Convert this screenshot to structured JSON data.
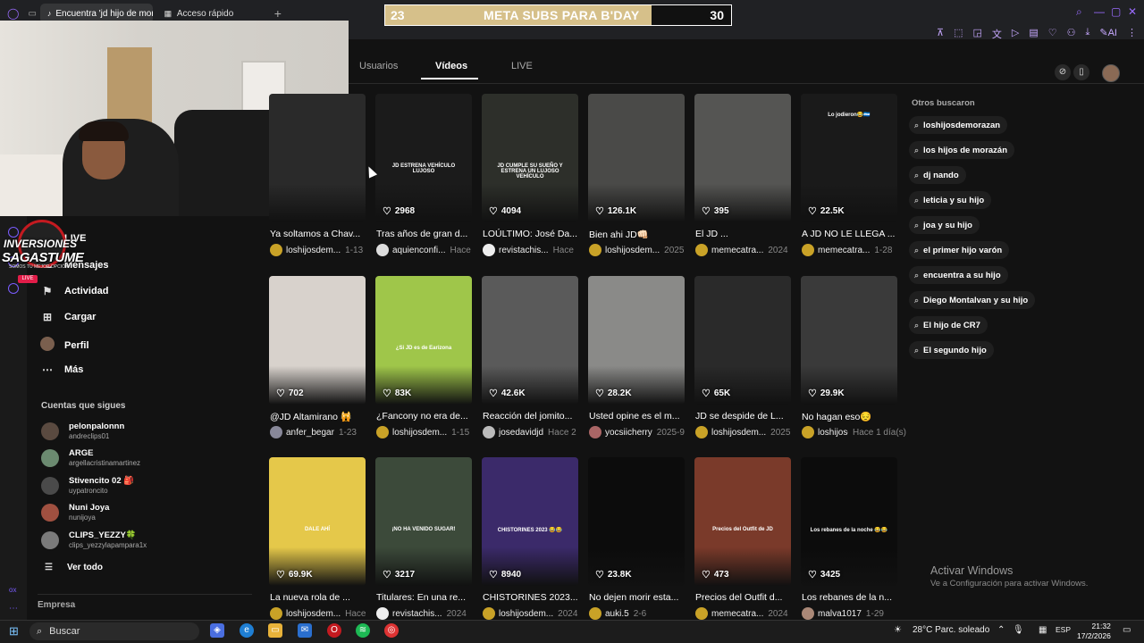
{
  "browser": {
    "tabs": [
      {
        "label": "Encuentra 'jd hijo de mora",
        "active": true
      },
      {
        "label": "Acceso rápido",
        "active": false
      }
    ]
  },
  "subs_goal": {
    "current": "23",
    "title": "META SUBS PARA B'DAY",
    "goal": "30",
    "progress": 0.77
  },
  "tiktok": {
    "tabs": [
      {
        "label": "Usuarios",
        "active": false
      },
      {
        "label": "Vídeos",
        "active": true
      },
      {
        "label": "LIVE",
        "active": false
      }
    ]
  },
  "overlay_logo": {
    "line1": "INVERSIONES",
    "line2": "SAGASTUME",
    "sub": "SOMOS TU MEJOR OPCIÓN",
    "live": "LIVE"
  },
  "sidebar": {
    "items": [
      {
        "icon": "live-icon",
        "label": "LIVE"
      },
      {
        "icon": "messages-icon",
        "label": "Mensajes"
      },
      {
        "icon": "activity-icon",
        "label": "Actividad"
      },
      {
        "icon": "upload-icon",
        "label": "Cargar"
      },
      {
        "icon": "profile-icon",
        "label": "Perfil"
      },
      {
        "icon": "more-icon",
        "label": "Más"
      }
    ],
    "following_header": "Cuentas que sigues",
    "following": [
      {
        "name": "pelonpalonnn",
        "user": "andreclips01",
        "color": "#5a4a40"
      },
      {
        "name": "ARGE",
        "user": "argellacristinamartinez",
        "color": "#6b8a70"
      },
      {
        "name": "Stivencito 02 🎒",
        "user": "uypatroncito",
        "color": "#4a4a4a"
      },
      {
        "name": "Nuni Joya",
        "user": "nunijoya",
        "color": "#a05040"
      },
      {
        "name": "CLIPS_YEZZY🍀",
        "user": "clips_yezzylapampara1x",
        "color": "#7a7a7a"
      }
    ],
    "see_all": "Ver todo",
    "company": "Empresa"
  },
  "videos": [
    {
      "title": "Ya soltamos a Chav...",
      "author": "loshijosdem...",
      "date": "1-13",
      "likes": "",
      "bg": "#2a2a2a",
      "av": "#c9a227"
    },
    {
      "title": "Tras años de gran d...",
      "author": "aquienconfi...",
      "date": "Hace",
      "likes": "2968",
      "bg": "#1b1b1b",
      "av": "#ddd",
      "caption": "JD ESTRENA VEHÍCULO LUJOSO"
    },
    {
      "title": "LOÚLTIMO: José Da...",
      "author": "revistachis...",
      "date": "Hace",
      "likes": "4094",
      "bg": "#2d2f2a",
      "av": "#eee",
      "caption": "JD CUMPLE SU SUEÑO Y ESTRENA UN LUJOSO VEHÍCULO"
    },
    {
      "title": "Bien ahi JD👊🏻",
      "author": "loshijosdem...",
      "date": "2025",
      "likes": "126.1K",
      "bg": "#4a4a48",
      "av": "#c9a227"
    },
    {
      "title": "El JD ...",
      "author": "memecatra...",
      "date": "2024",
      "likes": "395",
      "bg": "#555553",
      "av": "#c9a227"
    },
    {
      "title": "A JD NO LE LLEGA ...",
      "author": "memecatra...",
      "date": "1-28",
      "likes": "22.5K",
      "bg": "#1a1a1a",
      "av": "#c9a227",
      "caption": "Lo jodieron😂🇭🇳"
    },
    {
      "title": "@JD Altamirano 🙀",
      "author": "anfer_begar",
      "date": "1-23",
      "likes": "702",
      "bg": "#d8d2cc",
      "av": "#889"
    },
    {
      "title": "¿Fancony no era de...",
      "author": "loshijosdem...",
      "date": "1-15",
      "likes": "83K",
      "bg": "#9fc64a",
      "av": "#c9a227",
      "caption": "¿Si JD es de Earizona"
    },
    {
      "title": "Reacción del jomito...",
      "author": "josedavidjd",
      "date": "Hace 2",
      "likes": "42.6K",
      "bg": "#5a5a5a",
      "av": "#bbb"
    },
    {
      "title": "Usted opine es el m...",
      "author": "yocsiicherry",
      "date": "2025-9",
      "likes": "28.2K",
      "bg": "#8a8a88",
      "av": "#a66"
    },
    {
      "title": "JD se despide de L...",
      "author": "loshijosdem...",
      "date": "2025",
      "likes": "65K",
      "bg": "#2a2a2a",
      "av": "#c9a227"
    },
    {
      "title": "No hagan eso😔",
      "author": "loshijosdem...",
      "date": "Hace 1 día(s)",
      "likes": "29.9K",
      "bg": "#3a3a3a",
      "av": "#c9a227"
    },
    {
      "title": "La nueva rola de ...",
      "author": "loshijosdem...",
      "date": "Hace",
      "likes": "69.9K",
      "bg": "#e5c84a",
      "av": "#c9a227",
      "caption": "DALE AHÍ"
    },
    {
      "title": "Titulares: En una re...",
      "author": "revistachis...",
      "date": "2024",
      "likes": "3217",
      "bg": "#3c4a3a",
      "av": "#eee",
      "caption": "¡NO HA VENIDO SUGAR!"
    },
    {
      "title": "CHISTORINES 2023...",
      "author": "loshijosdem...",
      "date": "2024",
      "likes": "8940",
      "bg": "#3b2a6a",
      "av": "#c9a227",
      "caption": "CHISTORINES 2023 😂😂"
    },
    {
      "title": "No dejen morir esta...",
      "author": "auki.5",
      "date": "2-6",
      "likes": "23.8K",
      "bg": "#0c0c0c",
      "av": "#c9a227"
    },
    {
      "title": "Precios del Outfit d...",
      "author": "memecatra...",
      "date": "2024",
      "likes": "473",
      "bg": "#7a3a2a",
      "av": "#c9a227",
      "caption": "Precios del Outfit de JD"
    },
    {
      "title": "Los rebanes de la n...",
      "author": "malva1017",
      "date": "1-29",
      "likes": "3425",
      "bg": "#0c0c0c",
      "av": "#a87",
      "caption": "Los rebanes de la noche 😂😂"
    }
  ],
  "related": {
    "header": "Otros buscaron",
    "items": [
      "loshijosdemorazan",
      "los hijos de morazán",
      "dj nando",
      "leticia y su hijo",
      "joa y su hijo",
      "el primer hijo varón",
      "encuentra a su hijo",
      "Diego Montalvan y su hijo",
      "El hijo de CR7",
      "El segundo hijo"
    ]
  },
  "activate": {
    "line1": "Activar Windows",
    "line2": "Ve a Configuración para activar Windows."
  },
  "taskbar": {
    "search_placeholder": "Buscar",
    "weather": "28°C  Parc. soleado",
    "lang": "ESP",
    "time": "21:32",
    "date": "17/2/2026"
  }
}
